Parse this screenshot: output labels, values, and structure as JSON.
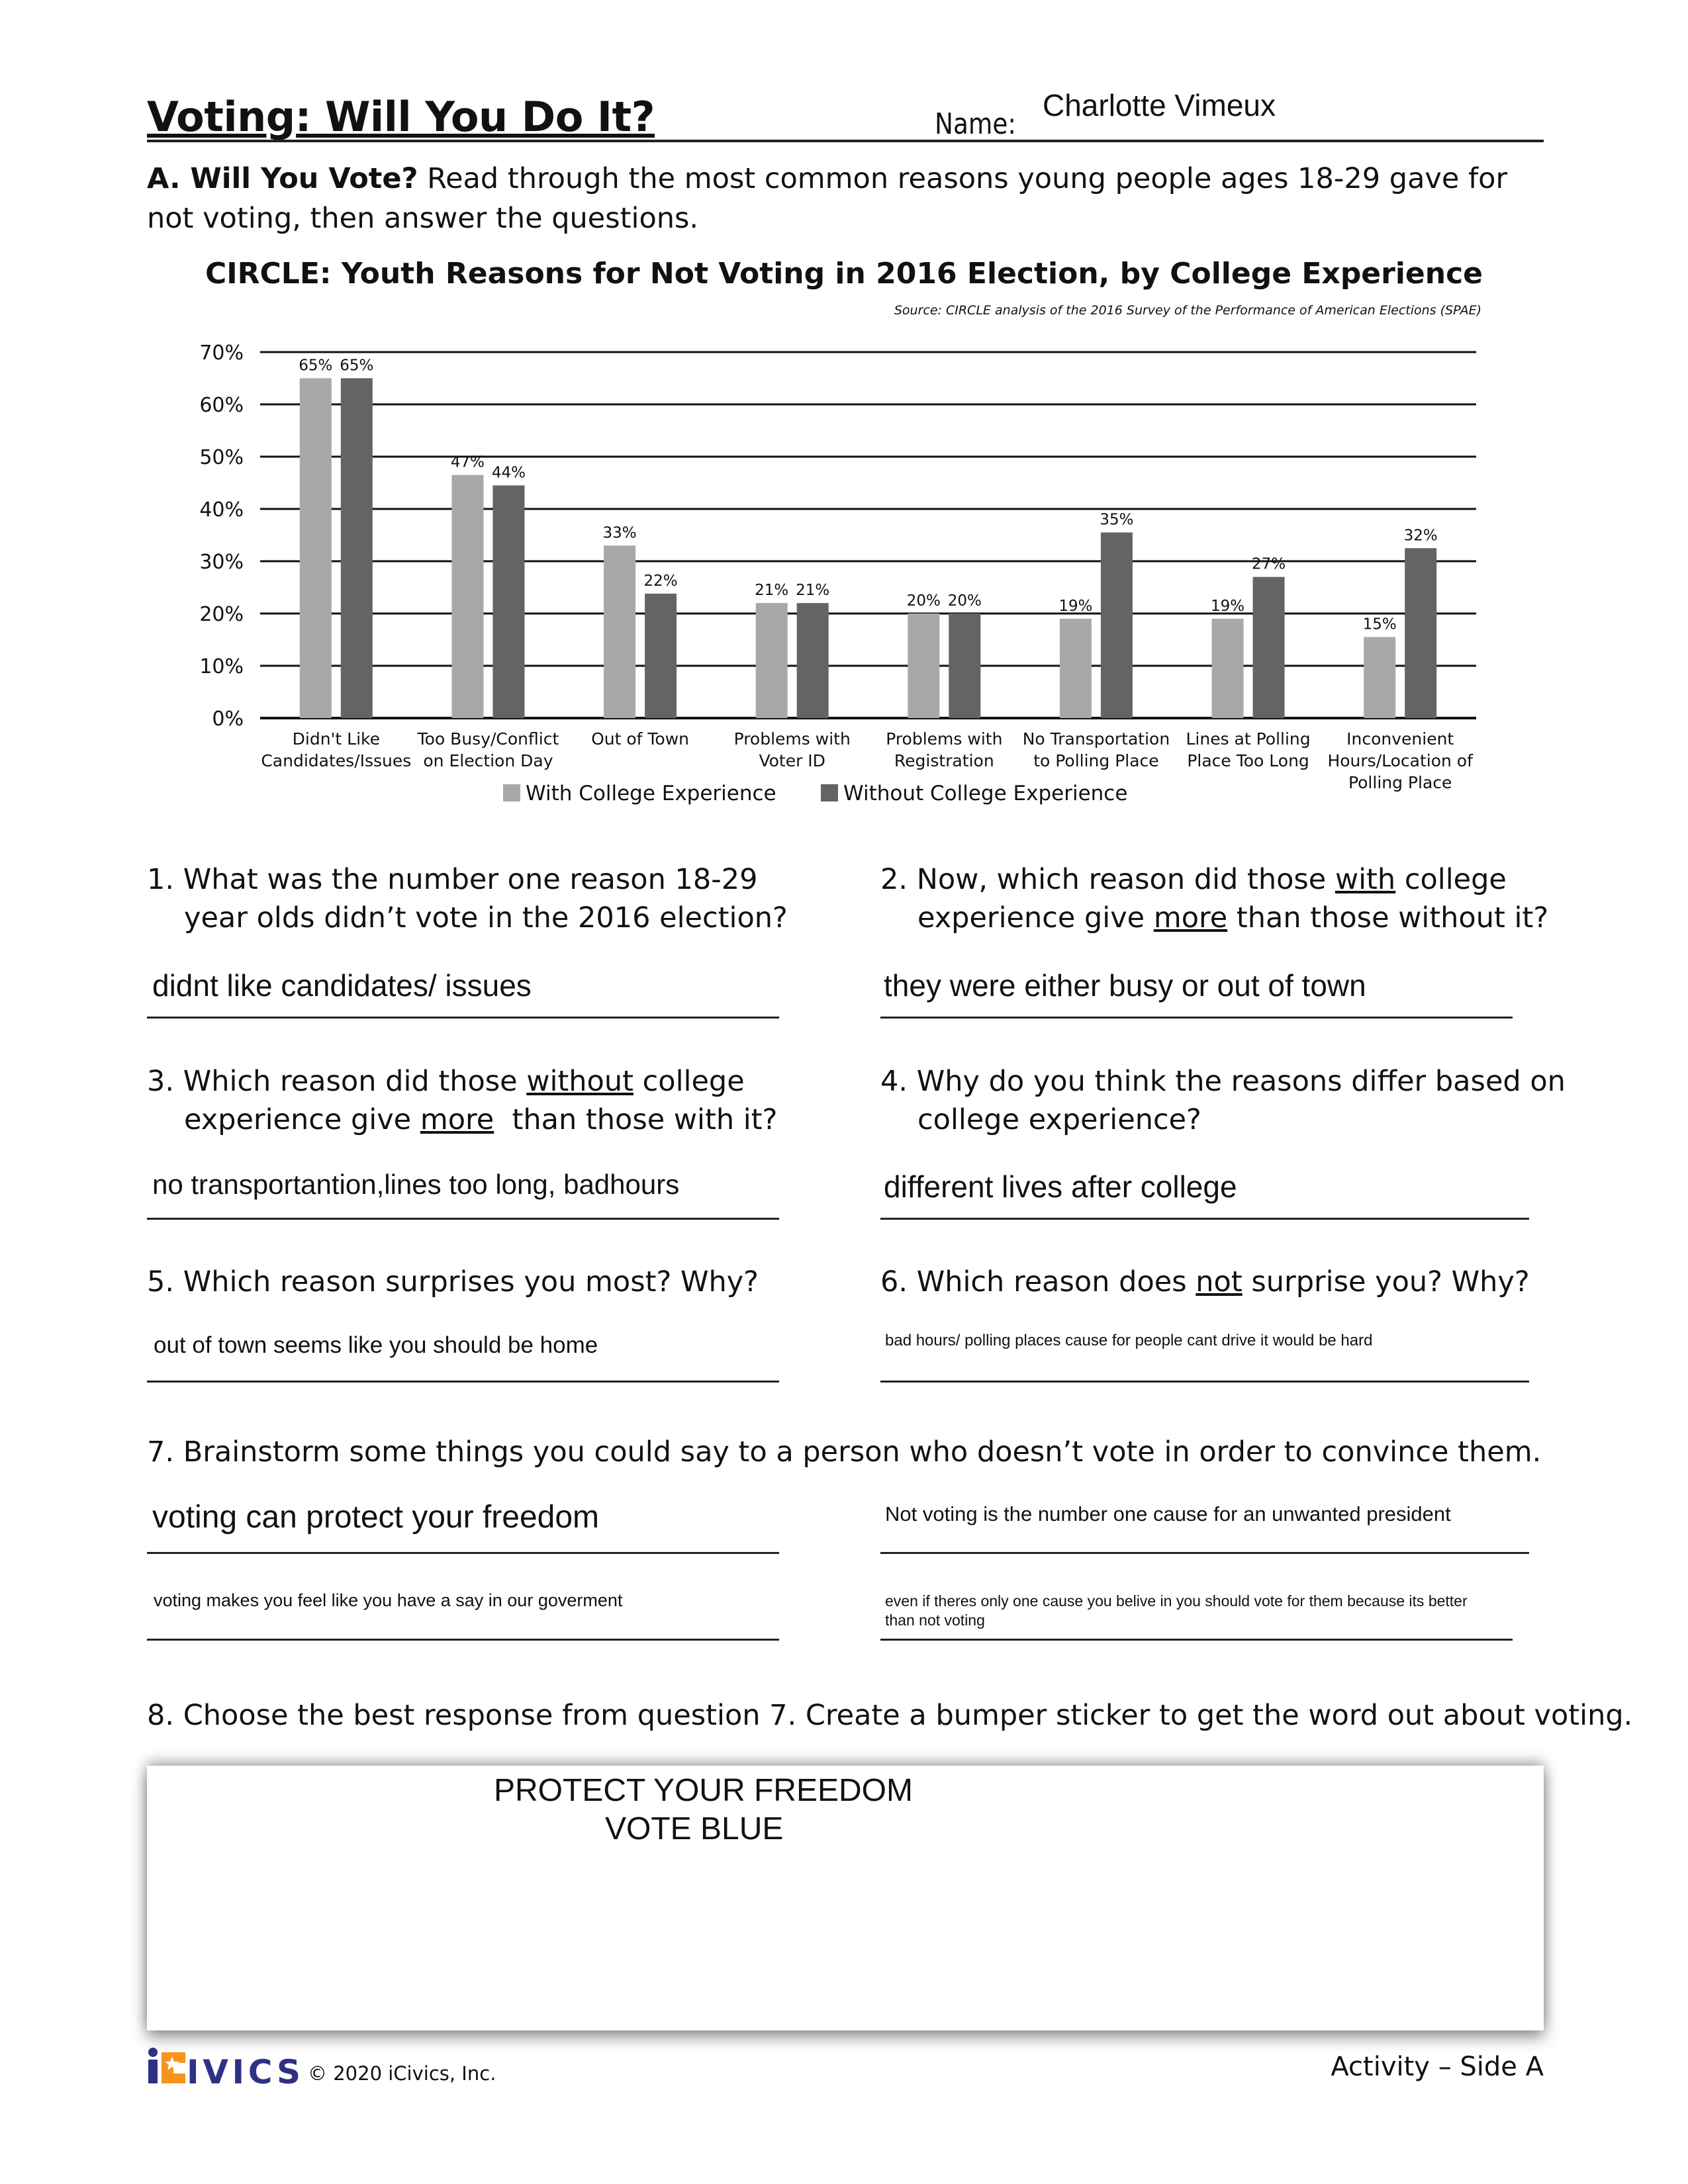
{
  "header": {
    "title": "Voting: Will You Do It?",
    "name_label": "Name:",
    "name_value": "Charlotte Vimeux"
  },
  "section_a": {
    "heading": "A. Will You Vote?",
    "instructions": " Read through the most common reasons young people ages 18-29 gave for not voting, then answer the questions."
  },
  "chart_data": {
    "type": "bar",
    "title": "CIRCLE: Youth Reasons for Not Voting in 2016 Election, by College Experience",
    "source": "Source: CIRCLE analysis of the 2016 Survey of the Performance of American Elections (SPAE)",
    "xlabel": "",
    "ylabel": "",
    "ylim": [
      0,
      70
    ],
    "yticks": [
      "0%",
      "10%",
      "20%",
      "30%",
      "40%",
      "50%",
      "60%",
      "70%"
    ],
    "grid": true,
    "legend_position": "bottom-center",
    "categories": [
      [
        "Didn't Like",
        "Candidates/Issues"
      ],
      [
        "Too Busy/Conflict",
        "on Election Day"
      ],
      [
        "Out of Town"
      ],
      [
        "Problems with",
        "Voter ID"
      ],
      [
        "Problems with",
        "Registration"
      ],
      [
        "No Transportation",
        "to Polling Place"
      ],
      [
        "Lines at Polling",
        "Place Too Long"
      ],
      [
        "Inconvenient",
        "Hours/Location of",
        "Polling Place"
      ]
    ],
    "series": [
      {
        "name": "With College Experience",
        "color": "#a7a8aa",
        "values": [
          65,
          46.5,
          33,
          22,
          20,
          19,
          19,
          15.5
        ],
        "labels": [
          "65%",
          "47%",
          "33%",
          "21%",
          "20%",
          "19%",
          "19%",
          "15%"
        ]
      },
      {
        "name": "Without College Experience",
        "color": "#636466",
        "values": [
          65,
          44.5,
          23.8,
          22,
          20,
          35.5,
          27,
          32.5
        ],
        "labels": [
          "65%",
          "44%",
          "22%",
          "21%",
          "20%",
          "35%",
          "27%",
          "32%"
        ]
      }
    ]
  },
  "questions": {
    "q1": {
      "line1": "1. What was the number one reason 18-29",
      "line2": "year olds didn’t vote in the 2016 election?",
      "answer": "didnt like candidates/ issues"
    },
    "q2": {
      "pre": "2. Now, which reason did those ",
      "u1": "with",
      "post1": " college",
      "line2_pre": "experience give ",
      "u2": "more",
      "line2_post": " than those without it?",
      "answer": "they were either busy or out of town"
    },
    "q3": {
      "pre": "3. Which reason did those ",
      "u1": "without",
      "post1": " college",
      "line2_pre": "experience give ",
      "u2": "more",
      "line2_post": "  than those with it?",
      "answer": "no transportantion,lines too long, badhours"
    },
    "q4": {
      "line1": "4. Why do you think the reasons differ based on",
      "line2": "college experience?",
      "answer": "different lives after college"
    },
    "q5": {
      "line1": "5. Which reason surprises you most? Why?",
      "answer": "out of town seems like you should be home"
    },
    "q6": {
      "pre": "6. Which reason does ",
      "u1": "not",
      "post1": " surprise you? Why?",
      "answer": "bad hours/ polling places cause for people cant drive it would be hard"
    },
    "q7": {
      "prompt": "7. Brainstorm some things you could say to a person who doesn’t vote in order to convince them.",
      "answers": [
        "voting can protect your freedom",
        "Not voting is the number one cause for an unwanted president",
        "voting makes you feel like you have a say in our goverment",
        "even if theres only one cause you belive in you should vote for them because its better than not voting"
      ]
    },
    "q8": {
      "prompt": "8. Choose the best response from question 7. Create a bumper sticker to get the word out about voting.",
      "sticker_line1": "PROTECT YOUR FREEDOM",
      "sticker_line2": "VOTE BLUE"
    }
  },
  "footer": {
    "logo_text": "iCivics",
    "logo_colors": {
      "navy": "#2e3183",
      "orange": "#f7941d"
    },
    "copyright": "© 2020 iCivics, Inc.",
    "side_label": "Activity – Side A"
  }
}
